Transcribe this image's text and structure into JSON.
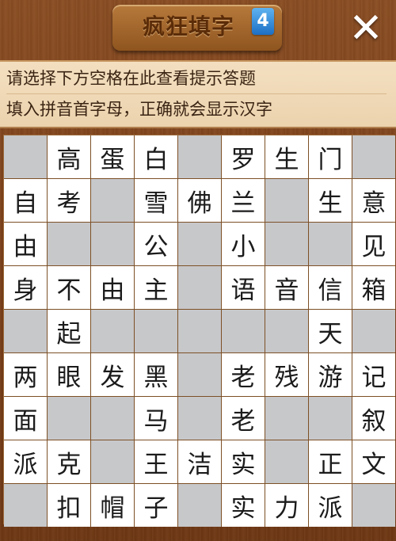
{
  "header": {
    "title": "疯狂填字",
    "badge": "4",
    "close_label": "✕"
  },
  "hint": {
    "line1": "请选择下方空格在此查看提示答题",
    "line2": "填入拼音首字母，正确就会显示汉字"
  },
  "grid": {
    "rows": [
      [
        "",
        "高",
        "蛋",
        "白",
        "",
        "罗",
        "生",
        "门",
        ""
      ],
      [
        "自",
        "考",
        "",
        "雪",
        "佛",
        "兰",
        "",
        "生",
        "意"
      ],
      [
        "由",
        "",
        "",
        "公",
        "",
        "小",
        "",
        "",
        "见"
      ],
      [
        "身",
        "不",
        "由",
        "主",
        "",
        "语",
        "音",
        "信",
        "箱"
      ],
      [
        "",
        "起",
        "",
        "",
        "",
        "",
        "",
        "天",
        ""
      ],
      [
        "两",
        "眼",
        "发",
        "黑",
        "",
        "老",
        "残",
        "游",
        "记"
      ],
      [
        "面",
        "",
        "",
        "马",
        "",
        "老",
        "",
        "",
        "叙"
      ],
      [
        "派",
        "克",
        "",
        "王",
        "洁",
        "实",
        "",
        "正",
        "文"
      ],
      [
        "",
        "扣",
        "帽",
        "子",
        "",
        "实",
        "力",
        "派",
        ""
      ]
    ]
  },
  "colors": {
    "wood": "#7a3f18",
    "hint_panel": "#f0d9b6",
    "filled_cell": "#ffffff",
    "empty_cell": "#c7c8ca",
    "badge": "#2a84d8"
  }
}
